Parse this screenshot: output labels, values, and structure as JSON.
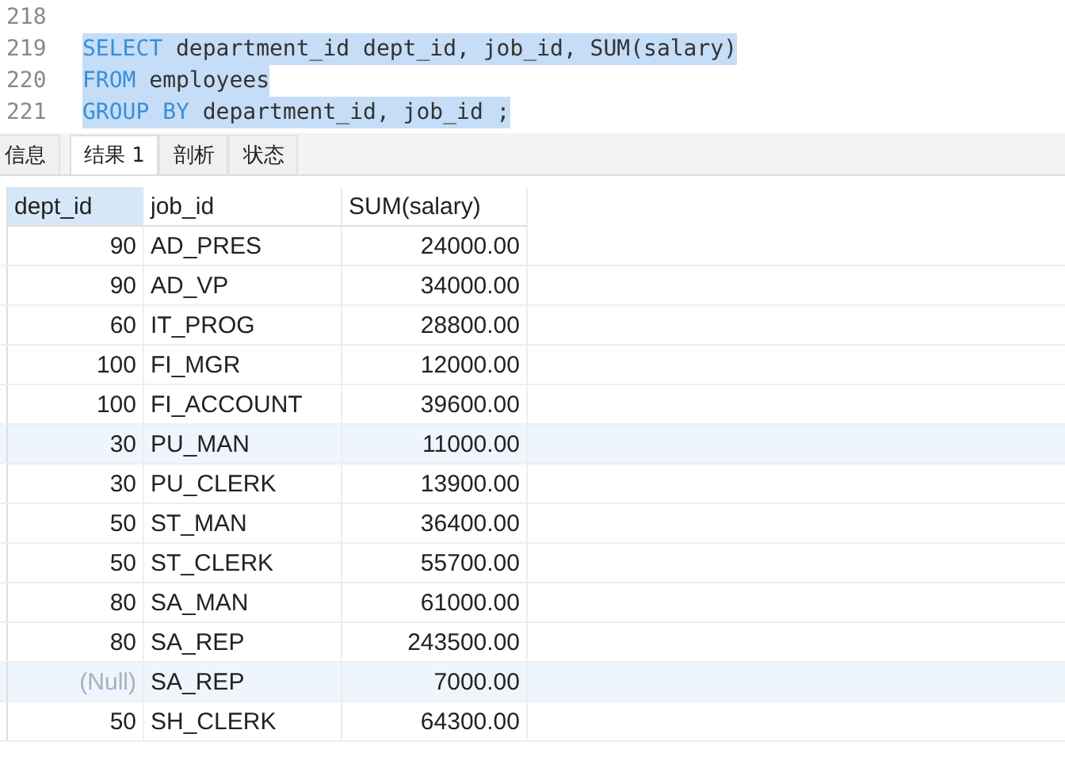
{
  "editor": {
    "lines": [
      {
        "number": "218"
      },
      {
        "number": "219",
        "selected": true,
        "tokens": [
          {
            "kind": "keyword",
            "text": "SELECT"
          },
          {
            "kind": "plain",
            "text": " department_id dept_id, job_id, SUM(salary)"
          }
        ]
      },
      {
        "number": "220",
        "selected": true,
        "tokens": [
          {
            "kind": "keyword",
            "text": "FROM"
          },
          {
            "kind": "plain",
            "text": " employees"
          }
        ]
      },
      {
        "number": "221",
        "selected": true,
        "tokens": [
          {
            "kind": "keyword",
            "text": "GROUP BY"
          },
          {
            "kind": "plain",
            "text": " department_id, job_id ;"
          }
        ]
      }
    ]
  },
  "tabs": [
    {
      "label": "信息",
      "selected": false
    },
    {
      "label": "结果 1",
      "selected": true
    },
    {
      "label": "剖析",
      "selected": false
    },
    {
      "label": "状态",
      "selected": false
    }
  ],
  "table": {
    "columns": [
      {
        "label": "dept_id",
        "selected": true
      },
      {
        "label": "job_id",
        "selected": false
      },
      {
        "label": "SUM(salary)",
        "selected": false
      }
    ],
    "rows": [
      {
        "dept_id": "90",
        "job_id": "AD_PRES",
        "sum": "24000.00",
        "is_null": false,
        "highlighted": false
      },
      {
        "dept_id": "90",
        "job_id": "AD_VP",
        "sum": "34000.00",
        "is_null": false,
        "highlighted": false
      },
      {
        "dept_id": "60",
        "job_id": "IT_PROG",
        "sum": "28800.00",
        "is_null": false,
        "highlighted": false
      },
      {
        "dept_id": "100",
        "job_id": "FI_MGR",
        "sum": "12000.00",
        "is_null": false,
        "highlighted": false
      },
      {
        "dept_id": "100",
        "job_id": "FI_ACCOUNT",
        "sum": "39600.00",
        "is_null": false,
        "highlighted": false
      },
      {
        "dept_id": "30",
        "job_id": "PU_MAN",
        "sum": "11000.00",
        "is_null": false,
        "highlighted": true
      },
      {
        "dept_id": "30",
        "job_id": "PU_CLERK",
        "sum": "13900.00",
        "is_null": false,
        "highlighted": false
      },
      {
        "dept_id": "50",
        "job_id": "ST_MAN",
        "sum": "36400.00",
        "is_null": false,
        "highlighted": false
      },
      {
        "dept_id": "50",
        "job_id": "ST_CLERK",
        "sum": "55700.00",
        "is_null": false,
        "highlighted": false
      },
      {
        "dept_id": "80",
        "job_id": "SA_MAN",
        "sum": "61000.00",
        "is_null": false,
        "highlighted": false
      },
      {
        "dept_id": "80",
        "job_id": "SA_REP",
        "sum": "243500.00",
        "is_null": false,
        "highlighted": false
      },
      {
        "dept_id": "(Null)",
        "job_id": "SA_REP",
        "sum": "7000.00",
        "is_null": true,
        "highlighted": true
      },
      {
        "dept_id": "50",
        "job_id": "SH_CLERK",
        "sum": "64300.00",
        "is_null": false,
        "highlighted": false
      }
    ]
  }
}
